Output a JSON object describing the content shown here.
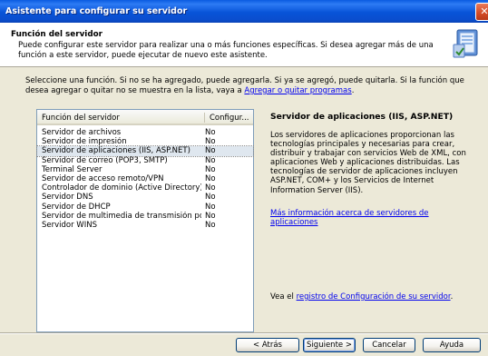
{
  "window": {
    "title": "Asistente para configurar su servidor",
    "close_glyph": "✕"
  },
  "header": {
    "title": "Función del servidor",
    "description": "Puede configurar este servidor para realizar una o más funciones específicas. Si desea agregar más de una función a este servidor, puede ejecutar de nuevo este asistente."
  },
  "intro": {
    "text": "Seleccione una función. Si no se ha agregado, puede agregarla. Si ya se agregó, puede quitarla. Si la función que desea agregar o quitar no se muestra en la lista, vaya a ",
    "link": "Agregar o quitar programas",
    "suffix": "."
  },
  "list": {
    "columns": [
      "Función del servidor",
      "Configur..."
    ],
    "selected_index": 2,
    "rows": [
      {
        "name": "Servidor de archivos",
        "status": "No"
      },
      {
        "name": "Servidor de impresión",
        "status": "No"
      },
      {
        "name": "Servidor de aplicaciones (IIS, ASP.NET)",
        "status": "No"
      },
      {
        "name": "Servidor de correo (POP3, SMTP)",
        "status": "No"
      },
      {
        "name": "Terminal Server",
        "status": "No"
      },
      {
        "name": "Servidor de acceso remoto/VPN",
        "status": "No"
      },
      {
        "name": "Controlador de dominio (Active Directory)",
        "status": "No"
      },
      {
        "name": "Servidor DNS",
        "status": "No"
      },
      {
        "name": "Servidor de DHCP",
        "status": "No"
      },
      {
        "name": "Servidor de multimedia de transmisión po...",
        "status": "No"
      },
      {
        "name": "Servidor WINS",
        "status": "No"
      }
    ]
  },
  "info": {
    "title": "Servidor de aplicaciones (IIS, ASP.NET)",
    "description": "Los servidores de aplicaciones proporcionan las tecnologías principales y necesarias para crear, distribuir y trabajar con servicios Web de XML, con aplicaciones Web y aplicaciones distribuidas. Las tecnologías de servidor de aplicaciones incluyen ASP.NET, COM+ y los Servicios de Internet Information Server (IIS).",
    "more_link": "Más información acerca de servidores de aplicaciones",
    "footer_prefix": "Vea el ",
    "footer_link": "registro de Configuración de su servidor",
    "footer_suffix": "."
  },
  "buttons": {
    "back": "< Atrás",
    "next": "Siguiente >",
    "cancel": "Cancelar",
    "help": "Ayuda"
  },
  "colors": {
    "title_bar": "#0854d8",
    "selection": "#dfe7ef",
    "link": "#0000ee",
    "dialog_bg": "#ece9d8"
  },
  "icons": {
    "header_icon": "server-wizard-icon"
  }
}
